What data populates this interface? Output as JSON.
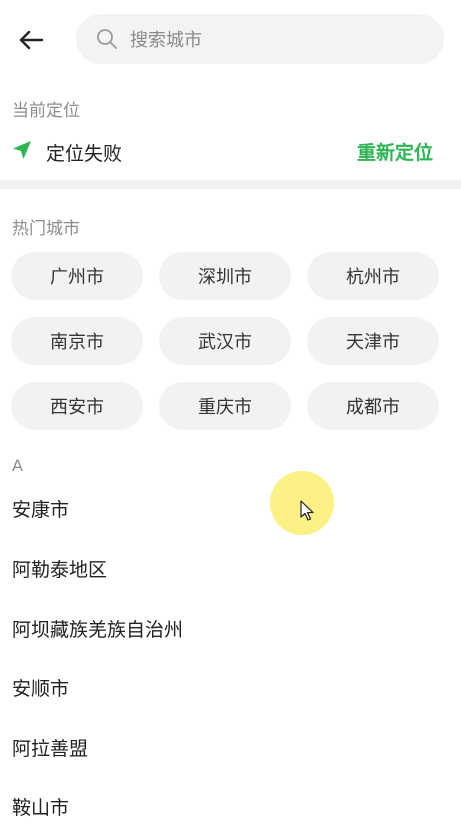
{
  "header": {
    "back_icon": "arrow-left-icon",
    "search": {
      "icon": "search-icon",
      "placeholder": "搜索城市",
      "value": ""
    }
  },
  "current_location": {
    "label": "当前定位",
    "icon": "location-arrow-icon",
    "status": "定位失败",
    "relocate_label": "重新定位"
  },
  "hot_cities": {
    "label": "热门城市",
    "items": [
      "广州市",
      "深圳市",
      "杭州市",
      "南京市",
      "武汉市",
      "天津市",
      "西安市",
      "重庆市",
      "成都市"
    ]
  },
  "city_index": {
    "letter": "A",
    "items": [
      "安康市",
      "阿勒泰地区",
      "阿坝藏族羌族自治州",
      "安顺市",
      "阿拉善盟",
      "鞍山市"
    ]
  },
  "colors": {
    "accent": "#2db453",
    "chip_bg": "#f2f2f2",
    "label_gray": "#8c8c8c",
    "cursor_halo": "#faee6e"
  }
}
